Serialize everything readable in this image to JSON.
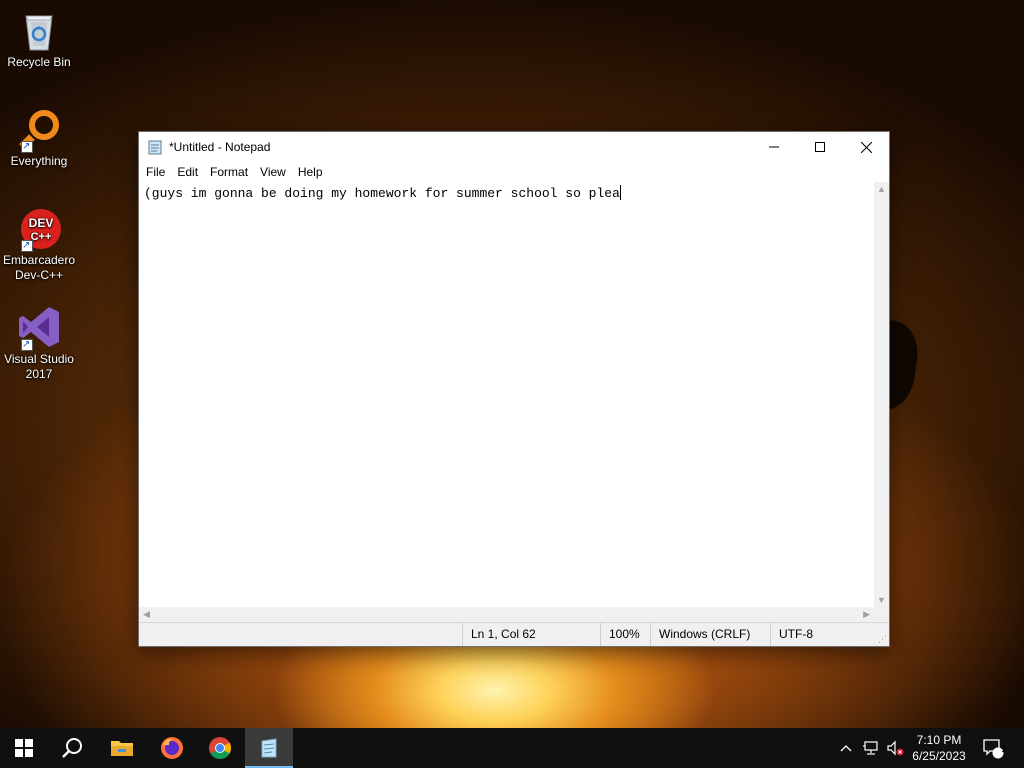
{
  "desktop": {
    "icons": [
      {
        "label_line1": "Recycle Bin",
        "label_line2": ""
      },
      {
        "label_line1": "Everything",
        "label_line2": ""
      },
      {
        "label_line1": "Embarcadero",
        "label_line2": "Dev-C++"
      },
      {
        "label_line1": "Visual Studio",
        "label_line2": "2017"
      }
    ],
    "devcpp_badge": {
      "top": "DEV",
      "bottom": "C++"
    }
  },
  "window": {
    "title": "*Untitled - Notepad",
    "menu": [
      "File",
      "Edit",
      "Format",
      "View",
      "Help"
    ],
    "content": "(guys im gonna be doing my homework for summer school so plea",
    "status": {
      "position": "Ln 1, Col 62",
      "zoom": "100%",
      "line_ending": "Windows (CRLF)",
      "encoding": "UTF-8"
    }
  },
  "taskbar": {
    "apps": [
      "start-icon",
      "search-icon",
      "file-explorer-icon",
      "firefox-icon",
      "chrome-icon",
      "notepad-icon"
    ],
    "active_app": "notepad-icon",
    "clock": {
      "time": "7:10 PM",
      "date": "6/25/2023"
    },
    "notification_count": "1"
  },
  "colors": {
    "accent": "#76b9ed",
    "taskbar": "#101010"
  }
}
